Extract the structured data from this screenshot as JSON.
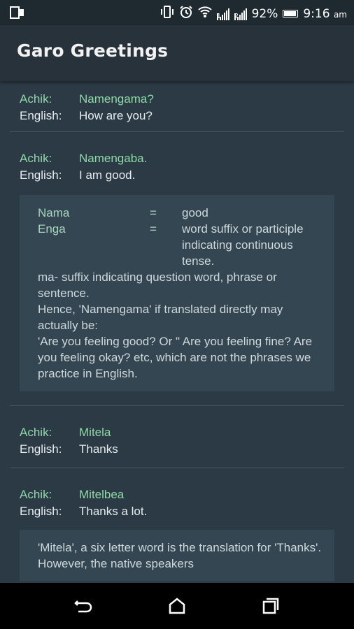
{
  "status_bar": {
    "battery": "92%",
    "time": "9:16",
    "ampm": "am",
    "icons": [
      "sim-icon",
      "vibrate-icon",
      "alarm-icon",
      "wifi-icon",
      "signal-icon",
      "signal-icon",
      "battery-icon"
    ]
  },
  "app": {
    "title": "Garo Greetings"
  },
  "entries": [
    {
      "achik_label": "Achik:",
      "achik": "Namengama?",
      "english_label": "English:",
      "english": "How are you?"
    },
    {
      "achik_label": "Achik:",
      "achik": "Namengaba.",
      "english_label": "English:",
      "english": "I am good."
    },
    {
      "achik_label": "Achik:",
      "achik": "Mitela",
      "english_label": "English:",
      "english": "Thanks"
    },
    {
      "achik_label": "Achik:",
      "achik": "Mitelbea",
      "english_label": "English:",
      "english": "Thanks a lot."
    }
  ],
  "note1": {
    "terms": [
      {
        "term": "Nama",
        "eq": "=",
        "definition": "good"
      },
      {
        "term": "Enga",
        "eq": "=",
        "definition": "word suffix or participle indicating continuous tense."
      }
    ],
    "paragraphs": [
      "ma- suffix indicating question word, phrase or sentence.",
      "Hence, 'Namengama' if translated directly may actually be:",
      "'Are you feeling good? Or \" Are you feeling fine? Are you feeling okay? etc, which are not the phrases we practice in English."
    ]
  },
  "note2": {
    "text": "'Mitela', a six letter  word is the translation for 'Thanks'. However, the native speakers"
  },
  "nav": {
    "icons": [
      "back-icon",
      "home-icon",
      "recents-icon"
    ]
  }
}
